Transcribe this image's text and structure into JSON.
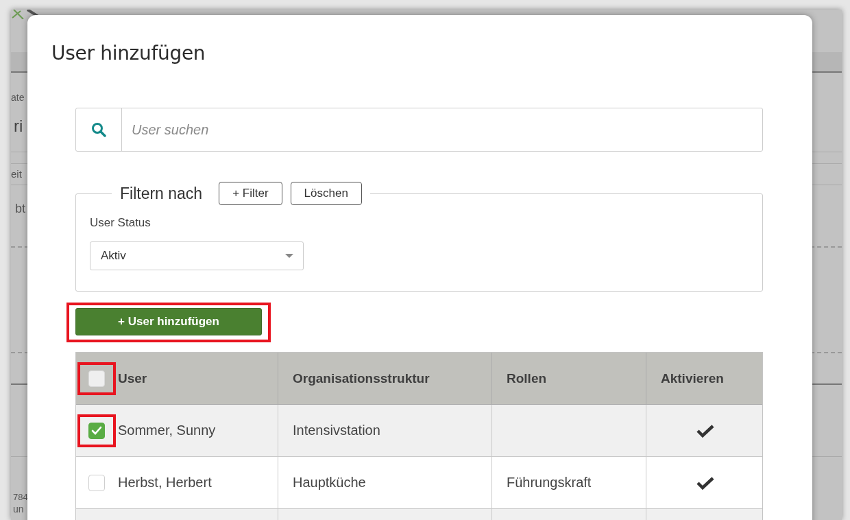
{
  "background": {
    "fragments": [
      "ate",
      "ri",
      "eit",
      "bt",
      "784",
      "un"
    ]
  },
  "dialog": {
    "title": "User hinzufügen",
    "search": {
      "placeholder": "User suchen"
    },
    "filter": {
      "legend": "Filtern nach",
      "buttons": [
        "+ Filter",
        "Löschen"
      ],
      "fields": [
        {
          "label": "User Status",
          "value": "Aktiv"
        }
      ]
    },
    "add_button": {
      "label": "+ User hinzufügen",
      "highlighted": true
    },
    "table": {
      "select_all": {
        "checked": false,
        "highlighted": true
      },
      "columns": [
        "User",
        "Organisationsstruktur",
        "Rollen",
        "Aktivieren"
      ],
      "rows": [
        {
          "checked": true,
          "highlighted": true,
          "user": "Sommer, Sunny",
          "org": "Intensivstation",
          "active": true
        },
        {
          "checked": false,
          "highlighted": false,
          "user": "Herbst, Herbert",
          "org": "Hauptküche",
          "role": "Führungskraft",
          "active": true
        }
      ]
    }
  }
}
